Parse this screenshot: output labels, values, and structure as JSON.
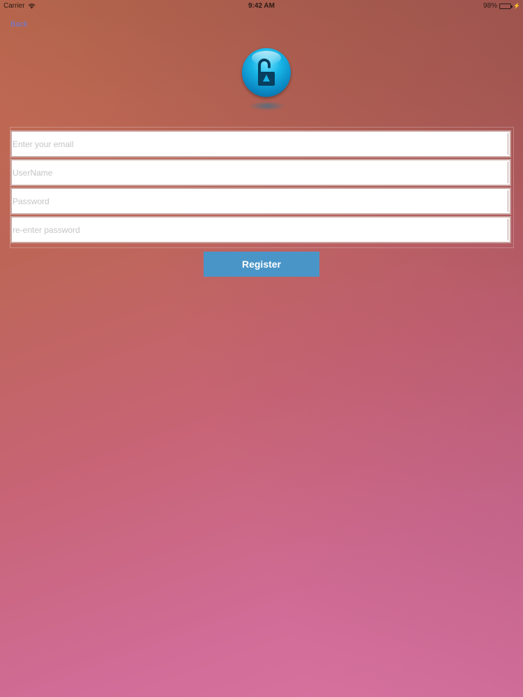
{
  "status_bar": {
    "carrier": "Carrier",
    "time": "9:42 AM",
    "battery_percent": "98%",
    "battery_level": 0.98
  },
  "nav": {
    "back_label": "Back"
  },
  "logo": {
    "icon": "open-lock-icon"
  },
  "form": {
    "email_placeholder": "Enter your email",
    "username_placeholder": "UserName",
    "password_placeholder": "Password",
    "reenter_placeholder": "re-enter password",
    "email_value": "",
    "username_value": "",
    "password_value": "",
    "reenter_value": ""
  },
  "register_label": "Register",
  "colors": {
    "accent_button": "#4a95c8",
    "back_link": "#6b7bd9",
    "logo_blue": "#17b4e6"
  }
}
